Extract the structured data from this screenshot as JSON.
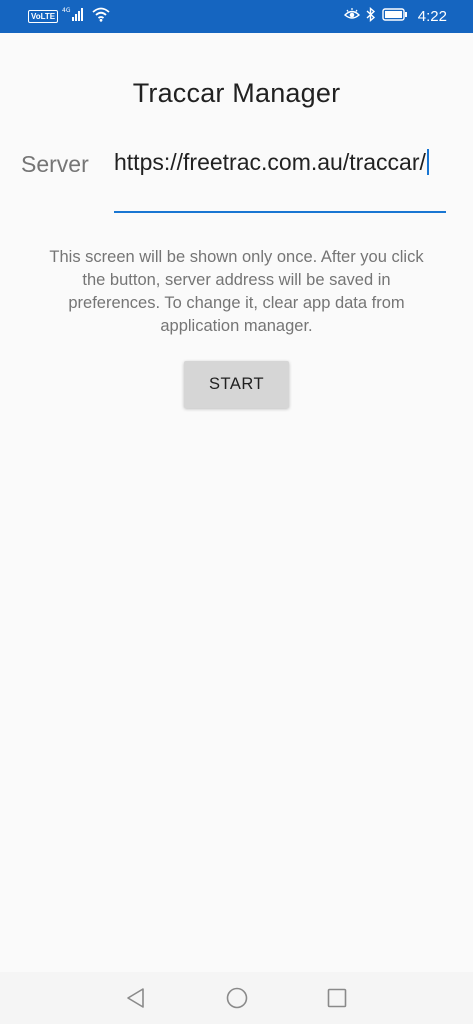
{
  "status_bar": {
    "network_badge": "VoLTE",
    "network_type": "4G",
    "time": "4:22",
    "icons": [
      "volte-icon",
      "signal-icon",
      "wifi-icon",
      "eye-comfort-icon",
      "bluetooth-icon",
      "battery-icon"
    ],
    "color": "#1565c0"
  },
  "app": {
    "title": "Traccar Manager"
  },
  "server": {
    "label": "Server",
    "value": "https://freetrac.com.au/traccar/",
    "accent_color": "#1976d2"
  },
  "info": {
    "text": "This screen will be shown only once. After you click the button, server address will be saved in preferences. To change it, clear app data from application manager."
  },
  "actions": {
    "start_label": "START"
  },
  "nav_bar": {
    "icons": [
      "back-icon",
      "home-icon",
      "recents-icon"
    ]
  }
}
